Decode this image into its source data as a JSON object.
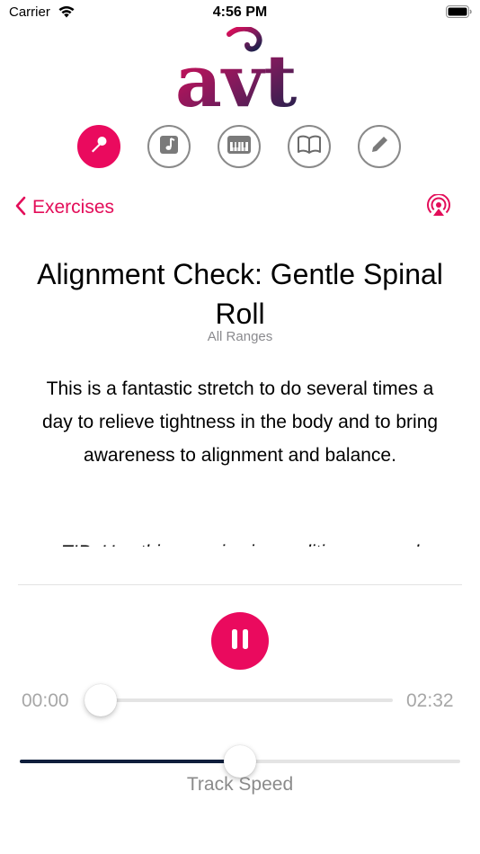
{
  "status_bar": {
    "carrier": "Carrier",
    "time": "4:56 PM"
  },
  "logo": {
    "text": "avt",
    "alt": "AVT logo"
  },
  "nav": {
    "items": [
      {
        "icon": "microphone-icon",
        "active": true
      },
      {
        "icon": "music-note-icon",
        "active": false
      },
      {
        "icon": "piano-icon",
        "active": false
      },
      {
        "icon": "book-icon",
        "active": false
      },
      {
        "icon": "pencil-icon",
        "active": false
      }
    ]
  },
  "back_label": "Exercises",
  "exercise": {
    "title": "Alignment Check: Gentle Spinal Roll",
    "range": "All Ranges",
    "description": "This is a fantastic stretch to do several times a day to relieve tightness in the body and to bring awareness to alignment and balance.",
    "tip_partial": "TIP: Use this exercise in conditions ranged"
  },
  "player": {
    "state": "playing",
    "elapsed": "00:00",
    "duration": "02:32",
    "progress": 0.0,
    "speed_label": "Track Speed",
    "speed_position": 0.5
  },
  "colors": {
    "accent": "#ea0a5e",
    "navy": "#0f1e3c",
    "gray": "#8a8a8a"
  }
}
